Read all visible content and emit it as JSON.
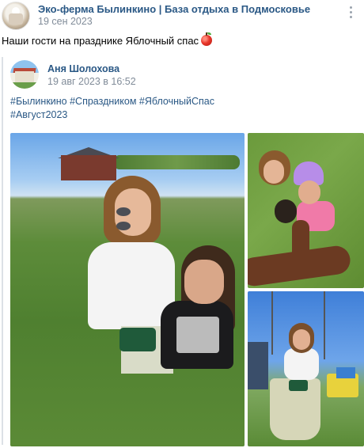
{
  "post": {
    "group_name": "Эко-ферма Былинкино | База отдыха в Подмосковье",
    "date": "19 сен 2023",
    "text": "Наши гости на празднике Яблочный спас",
    "text_emoji": "apple-icon"
  },
  "repost": {
    "author": "Аня Шолохова",
    "date": "19 авг 2023 в 16:52",
    "hashtags": [
      "#Былинкино",
      "#Спраздником",
      "#ЯблочныйСпас",
      "#Август2023"
    ]
  },
  "photos": [
    {
      "name": "photo-main",
      "subject": "woman and girl on grass"
    },
    {
      "name": "photo-top-right",
      "subject": "selfie with children"
    },
    {
      "name": "photo-bottom-right",
      "subject": "woman on swing"
    }
  ],
  "colors": {
    "link": "#2a5885",
    "meta": "#818c99",
    "divider": "#dce1e6"
  }
}
